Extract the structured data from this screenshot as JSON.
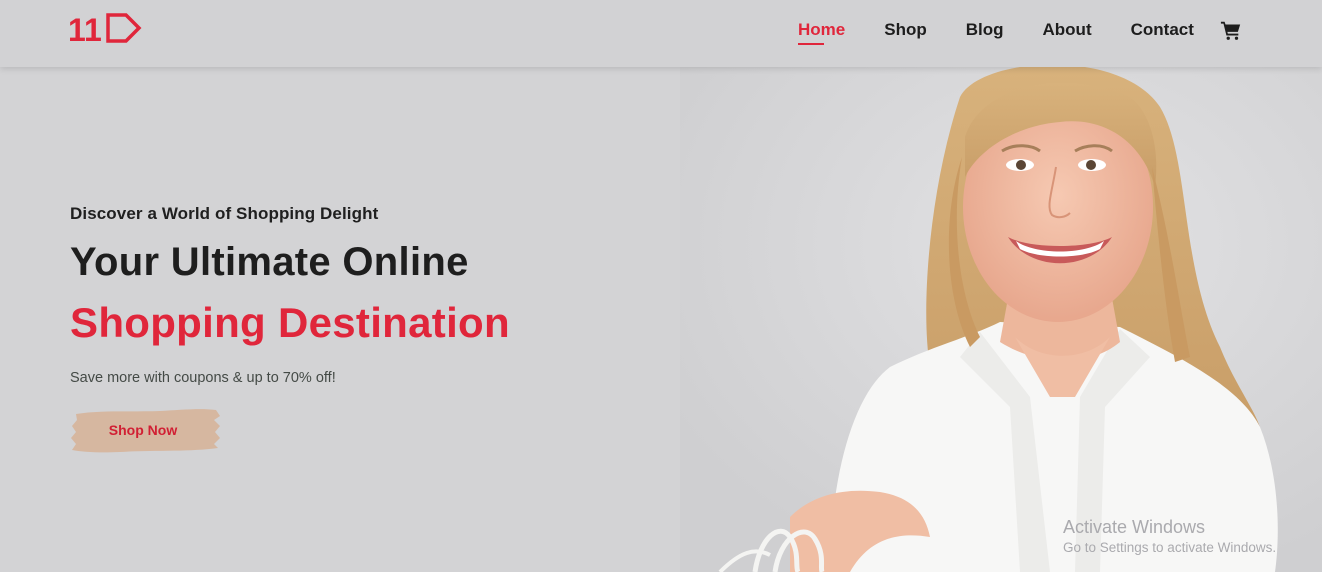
{
  "brand": {
    "logo_text": "11",
    "accent": "#e0263b"
  },
  "nav": {
    "items": [
      {
        "label": "Home",
        "active": true
      },
      {
        "label": "Shop",
        "active": false
      },
      {
        "label": "Blog",
        "active": false
      },
      {
        "label": "About",
        "active": false
      },
      {
        "label": "Contact",
        "active": false
      }
    ],
    "cart_icon": "shopping-cart-icon"
  },
  "hero": {
    "tagline": "Discover a World of Shopping Delight",
    "headline_line1": "Your Ultimate Online",
    "headline_line2": "Shopping Destination",
    "subtext": "Save more with coupons & up to 70% off!",
    "cta_label": "Shop Now",
    "cta_color": "#d6b7a0",
    "image": "smiling-woman-holding-shopping-bag"
  },
  "watermark": {
    "title": "Activate Windows",
    "subtitle": "Go to Settings to activate Windows."
  }
}
